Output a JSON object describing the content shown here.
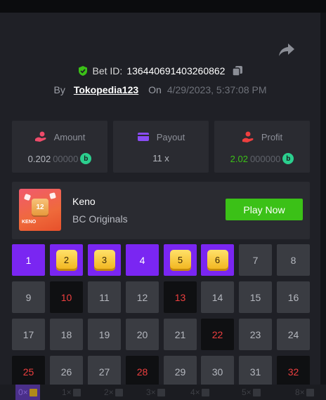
{
  "bet": {
    "id_label": "Bet ID:",
    "id_value": "136440691403260862",
    "by_label": "By",
    "username": "Tokopedia123",
    "on_label": "On",
    "date": "4/29/2023, 5:37:08 PM"
  },
  "stats": [
    {
      "label": "Amount",
      "value_main": "0.202",
      "value_dim": "00000",
      "icon": "money-hand-icon",
      "value_color": "#b5b8bf",
      "show_coin": true
    },
    {
      "label": "Payout",
      "value_main": "11 x",
      "value_dim": "",
      "icon": "wallet-icon",
      "value_color": "#b5b8bf",
      "show_coin": false
    },
    {
      "label": "Profit",
      "value_main": "2.02",
      "value_dim": "000000",
      "icon": "profit-hand-icon",
      "value_color": "#3bc117",
      "show_coin": true
    }
  ],
  "game": {
    "name": "Keno",
    "provider": "BC Originals",
    "play_label": "Play Now",
    "thumb_label": "KENO",
    "thumb_number": "12"
  },
  "coin_symbol": "b",
  "colors": {
    "panel": "#1f2026",
    "card": "#2a2b31",
    "selected": "#7a26f2",
    "hit": "#f1b31a",
    "drawn_text": "#ee3f3f",
    "play_button": "#3bc117"
  },
  "grid": {
    "cells": [
      {
        "n": "1",
        "state": "sel"
      },
      {
        "n": "2",
        "state": "hit"
      },
      {
        "n": "3",
        "state": "hit"
      },
      {
        "n": "4",
        "state": "sel"
      },
      {
        "n": "5",
        "state": "hit"
      },
      {
        "n": "6",
        "state": "hit"
      },
      {
        "n": "7",
        "state": "norm"
      },
      {
        "n": "8",
        "state": "norm"
      },
      {
        "n": "9",
        "state": "norm"
      },
      {
        "n": "10",
        "state": "drawn"
      },
      {
        "n": "11",
        "state": "norm"
      },
      {
        "n": "12",
        "state": "norm"
      },
      {
        "n": "13",
        "state": "drawn"
      },
      {
        "n": "14",
        "state": "norm"
      },
      {
        "n": "15",
        "state": "norm"
      },
      {
        "n": "16",
        "state": "norm"
      },
      {
        "n": "17",
        "state": "norm"
      },
      {
        "n": "18",
        "state": "norm"
      },
      {
        "n": "19",
        "state": "norm"
      },
      {
        "n": "20",
        "state": "norm"
      },
      {
        "n": "21",
        "state": "norm"
      },
      {
        "n": "22",
        "state": "drawn"
      },
      {
        "n": "23",
        "state": "norm"
      },
      {
        "n": "24",
        "state": "norm"
      },
      {
        "n": "25",
        "state": "drawn"
      },
      {
        "n": "26",
        "state": "norm"
      },
      {
        "n": "27",
        "state": "norm"
      },
      {
        "n": "28",
        "state": "drawn"
      },
      {
        "n": "29",
        "state": "norm"
      },
      {
        "n": "30",
        "state": "norm"
      },
      {
        "n": "31",
        "state": "norm"
      },
      {
        "n": "32",
        "state": "drawn"
      }
    ]
  },
  "payout_table": [
    {
      "label": "0×",
      "active": true
    },
    {
      "label": "1×",
      "active": false
    },
    {
      "label": "2×",
      "active": false
    },
    {
      "label": "3×",
      "active": false
    },
    {
      "label": "4×",
      "active": false
    },
    {
      "label": "5×",
      "active": false
    },
    {
      "label": "8×",
      "active": false
    }
  ]
}
